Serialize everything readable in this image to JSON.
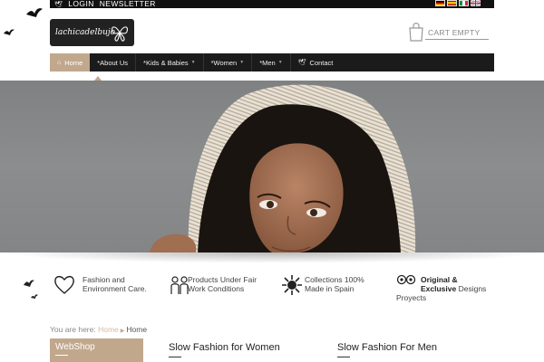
{
  "topbar": {
    "login": "LOGIN",
    "newsletter": "NEWSLETTER"
  },
  "flags": [
    {
      "icon": "german-flag-icon",
      "colors": [
        "#000000",
        "#dd0000",
        "#ffce00"
      ]
    },
    {
      "icon": "spanish-flag-icon",
      "colors": [
        "#aa151b",
        "#f1bf00",
        "#aa151b"
      ]
    },
    {
      "icon": "italian-flag-icon",
      "colors": [
        "#009246",
        "#ffffff",
        "#ce2b37"
      ]
    },
    {
      "icon": "uk-flag-icon",
      "colors": [
        "#012169",
        "#ffffff",
        "#c8102e"
      ]
    }
  ],
  "cart": {
    "label": "CART EMPTY"
  },
  "nav": {
    "items": [
      {
        "label": "Home",
        "active": true
      },
      {
        "label": "*About Us",
        "active": false
      },
      {
        "label": "*Kids & Babies",
        "active": false,
        "dropdown": true
      },
      {
        "label": "*Women",
        "active": false,
        "dropdown": true
      },
      {
        "label": "*Men",
        "active": false,
        "dropdown": true
      },
      {
        "label": "Contact",
        "active": false
      }
    ]
  },
  "features": [
    {
      "icon": "heart-icon",
      "line1": "Fashion and",
      "line2": "Environment Care."
    },
    {
      "icon": "hands-icon",
      "line1": "Products Under Fair",
      "line2": "Work Conditions"
    },
    {
      "icon": "sun-icon",
      "line1": "Collections 100%",
      "line2": "Made in Spain"
    },
    {
      "icon": "eyes-icon",
      "bold1": "Original &",
      "bold2": "Exclusive",
      "rest2": " Designs",
      "line3": "Proyects"
    }
  ],
  "breadcrumb": {
    "prefix": "You are here:",
    "home": "Home",
    "current": "Home"
  },
  "webshop": {
    "title": "WebShop"
  },
  "sections": {
    "women": "Slow Fashion for Women",
    "men": "Slow Fashion For Men"
  },
  "colors": {
    "accent": "#c1a88d",
    "nav_bg": "#1b1b1b",
    "topbar_bg": "#111111"
  }
}
